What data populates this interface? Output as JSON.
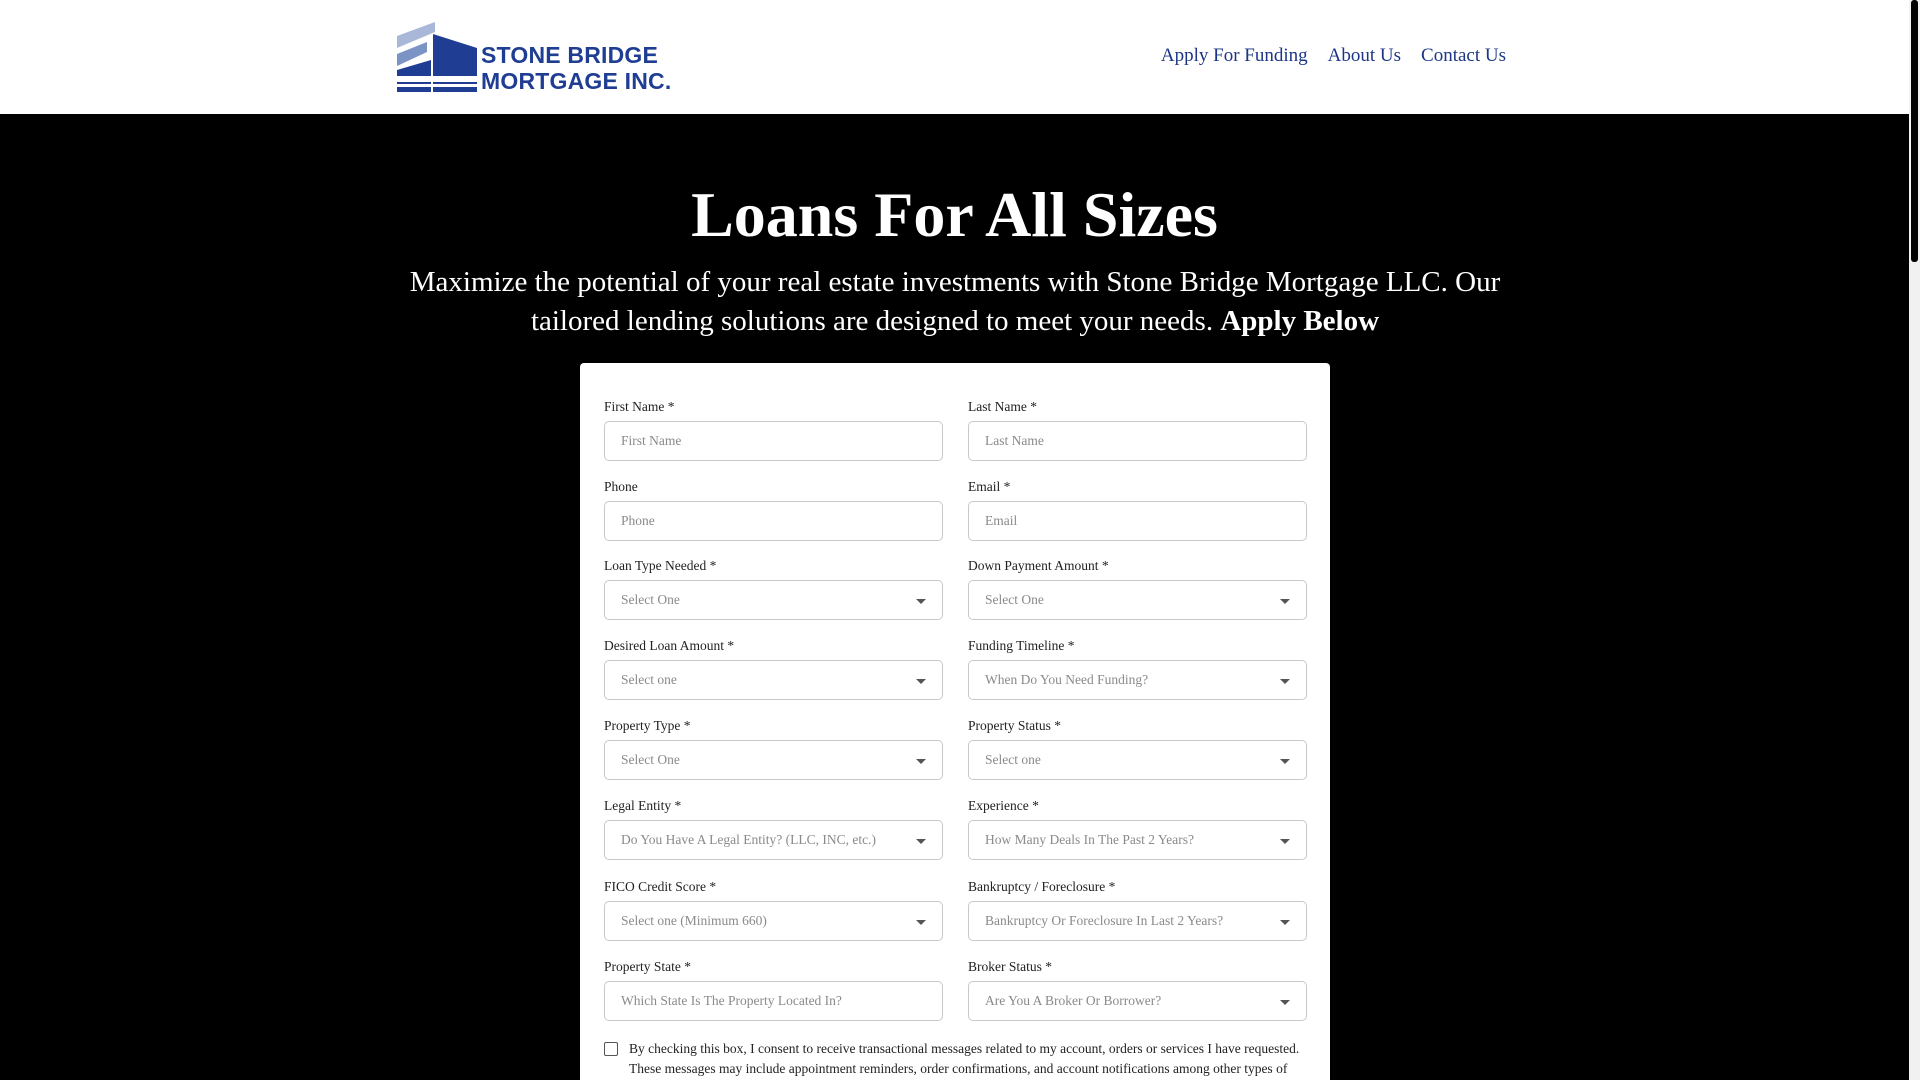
{
  "brand": {
    "logo_line1": "STONE BRIDGE",
    "logo_line2": "MORTGAGE INC.",
    "colors": {
      "primary": "#1f3d93",
      "light": "#a9b8d8"
    }
  },
  "nav": {
    "items": [
      {
        "label": "Apply For Funding"
      },
      {
        "label": "About Us"
      },
      {
        "label": "Contact Us"
      }
    ]
  },
  "hero": {
    "title": "Loans For All Sizes",
    "subtitle": "Maximize the potential of your real estate investments with Stone Bridge Mortgage LLC. Our tailored lending solutions are designed to meet your needs.",
    "subtitle_emphasis": "Apply Below"
  },
  "form": {
    "first_name": {
      "label": "First Name *",
      "placeholder": "First Name"
    },
    "last_name": {
      "label": "Last Name *",
      "placeholder": "Last Name"
    },
    "phone": {
      "label": "Phone",
      "placeholder": "Phone"
    },
    "email": {
      "label": "Email *",
      "placeholder": "Email"
    },
    "loan_type": {
      "label": "Loan Type Needed *",
      "value": "Select One"
    },
    "down_payment": {
      "label": "Down Payment Amount *",
      "value": "Select One"
    },
    "desired_loan": {
      "label": "Desired Loan Amount *",
      "value": "Select one"
    },
    "funding_timeline": {
      "label": "Funding Timeline *",
      "value": "When Do You Need Funding?"
    },
    "property_type": {
      "label": "Property Type *",
      "value": "Select One"
    },
    "property_status": {
      "label": "Property Status *",
      "value": "Select one"
    },
    "legal_entity": {
      "label": "Legal Entity *",
      "value": "Do You Have A Legal Entity? (LLC, INC, etc.)"
    },
    "experience": {
      "label": "Experience *",
      "value": "How Many Deals In The Past 2 Years?"
    },
    "fico": {
      "label": "FICO Credit Score *",
      "value": "Select one (Minimum 660)"
    },
    "bankruptcy": {
      "label": "Bankruptcy / Foreclosure *",
      "value": "Bankruptcy Or Foreclosure In Last 2 Years?"
    },
    "property_state": {
      "label": "Property State *",
      "placeholder": "Which State Is The Property Located In?"
    },
    "broker_status": {
      "label": "Broker Status *",
      "value": "Are You A Broker Or Borrower?"
    },
    "consent_text": "By checking this box, I consent to receive transactional messages related to my account, orders or services I have requested. These messages may include appointment reminders, order confirmations, and account notifications among other types of messages. Message frequency may vary. Message and Data rates may apply. Reply HELP for help or STOP to opt-out."
  }
}
